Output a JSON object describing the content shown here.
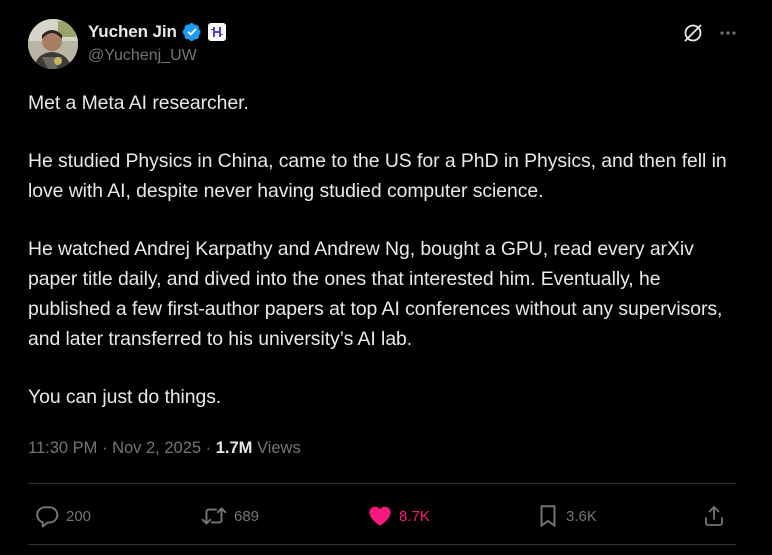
{
  "author": {
    "display_name": "Yuchen Jin",
    "handle": "@Yuchenj_UW",
    "avatar_icon": "avatar-photo",
    "verified_icon": "verified-badge-icon",
    "affiliation_icon": "hyperbolic-logo-icon"
  },
  "header_actions": {
    "grok_icon": "grok-icon",
    "more_icon": "more-dots-icon"
  },
  "body": {
    "paragraphs": [
      "Met a Meta AI researcher.",
      "He studied Physics in China, came to the US for a PhD in Physics, and then fell in love with AI, despite never having studied computer science.",
      "He watched Andrej Karpathy and Andrew Ng, bought a GPU, read every arXiv paper title daily, and dived into the ones that interested him. Eventually, he published a few first-author papers at top AI conferences without any supervisors, and later transferred to his university’s AI lab.",
      "You can just do things."
    ]
  },
  "meta": {
    "time": "11:30 PM",
    "separator": " · ",
    "date": "Nov 2, 2025",
    "views_count": "1.7M",
    "views_label": " Views"
  },
  "actions": {
    "replies": "200",
    "reposts": "689",
    "likes": "8.7K",
    "bookmarks": "3.6K",
    "like_color": "#f91880",
    "muted_color": "#71767b"
  }
}
